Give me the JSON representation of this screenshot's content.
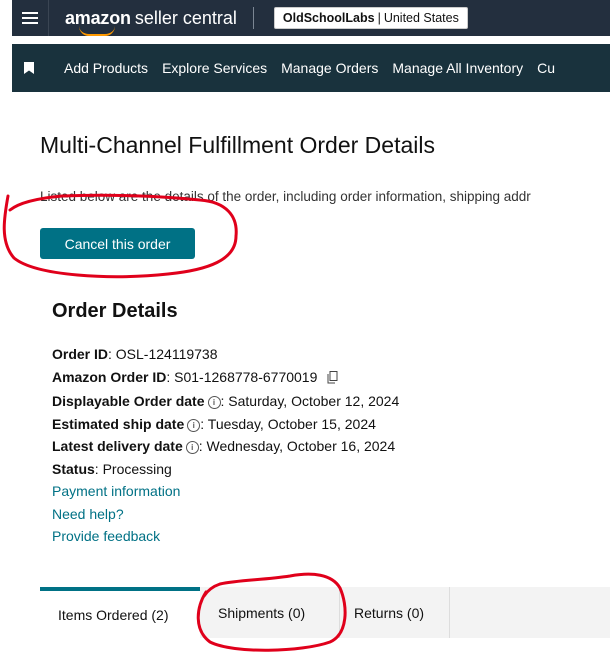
{
  "header": {
    "brand_main": "amazon",
    "brand_rest": "seller central",
    "account_name": "OldSchoolLabs",
    "separator": "|",
    "marketplace": "United States"
  },
  "nav": {
    "items": [
      "Add Products",
      "Explore Services",
      "Manage Orders",
      "Manage All Inventory",
      "Cu"
    ]
  },
  "page": {
    "title": "Multi-Channel Fulfillment Order Details",
    "intro": "Listed below are the details of the order, including order information, shipping addr",
    "cancel_label": "Cancel this order"
  },
  "order": {
    "heading": "Order Details",
    "order_id_label": "Order ID",
    "order_id": ": OSL-124119738",
    "amazon_order_id_label": "Amazon Order ID",
    "amazon_order_id": ": S01-1268778-6770019",
    "displayable_date_label": "Displayable Order date",
    "displayable_date": ": Saturday, October 12, 2024",
    "est_ship_label": "Estimated ship date",
    "est_ship": ": Tuesday, October 15, 2024",
    "latest_delivery_label": "Latest delivery date",
    "latest_delivery": ": Wednesday, October 16, 2024",
    "status_label": "Status",
    "status": ": Processing",
    "payment_link": "Payment information",
    "help_link": "Need help?",
    "feedback_link": "Provide feedback"
  },
  "tabs": [
    {
      "label": "Items Ordered (2)",
      "active": true
    },
    {
      "label": "Shipments (0)",
      "active": false
    },
    {
      "label": "Returns (0)",
      "active": false
    }
  ],
  "colors": {
    "header_bg": "#232f3e",
    "nav_bg": "#19323d",
    "accent": "#007185",
    "annotation": "#e0001b"
  }
}
